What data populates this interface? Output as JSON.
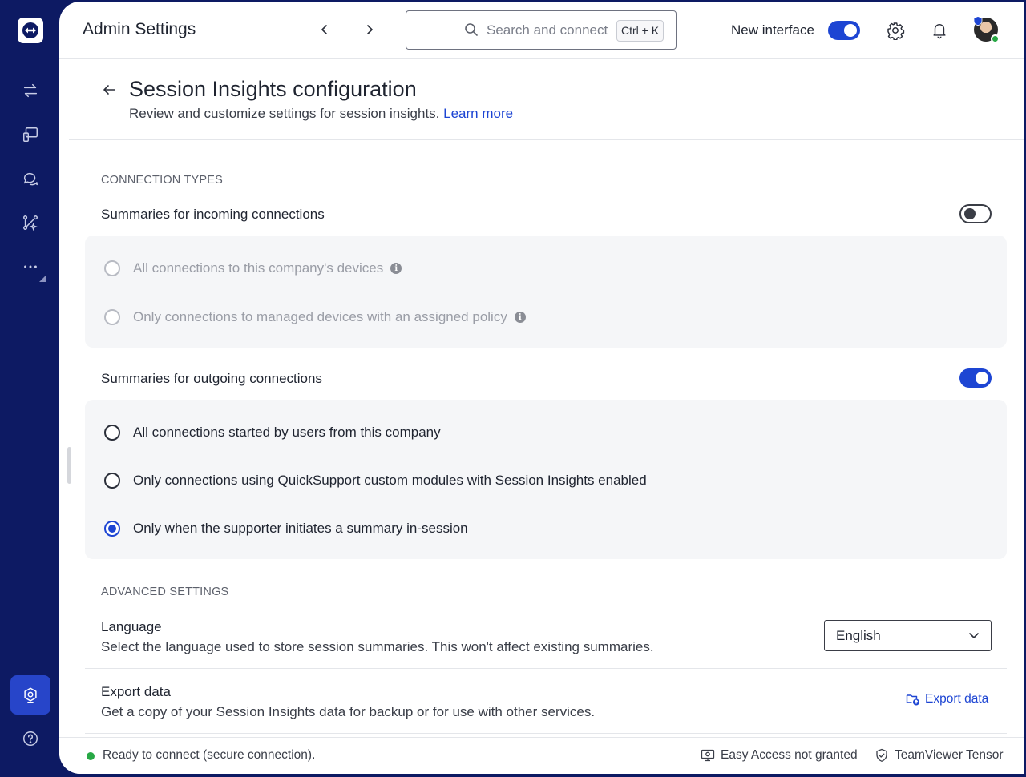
{
  "header": {
    "app_title": "Admin Settings",
    "search_placeholder": "Search and connect",
    "search_shortcut": "Ctrl + K",
    "new_interface_label": "New interface",
    "new_interface_enabled": true
  },
  "sidebar": {
    "items": [
      {
        "name": "remote-connect",
        "icon": "arrows-exchange-icon"
      },
      {
        "name": "devices",
        "icon": "devices-icon"
      },
      {
        "name": "chat",
        "icon": "chat-icon"
      },
      {
        "name": "integrations",
        "icon": "flow-sparkle-icon"
      },
      {
        "name": "more",
        "icon": "more-dots-icon"
      },
      {
        "name": "admin-settings",
        "icon": "admin-gear-shield-icon",
        "active": true
      },
      {
        "name": "help",
        "icon": "help-icon"
      }
    ]
  },
  "page": {
    "title": "Session Insights configuration",
    "subtitle": "Review and customize settings for session insights.",
    "learn_more": "Learn more"
  },
  "connection_types": {
    "section_label": "CONNECTION TYPES",
    "incoming": {
      "title": "Summaries for incoming connections",
      "enabled": false,
      "options": [
        {
          "label": "All connections to this company's devices",
          "checked": false,
          "disabled": true,
          "info": true
        },
        {
          "label": "Only connections to managed devices with an assigned policy",
          "checked": false,
          "disabled": true,
          "info": true
        }
      ]
    },
    "outgoing": {
      "title": "Summaries for outgoing connections",
      "enabled": true,
      "options": [
        {
          "label": "All connections started by users from this company",
          "checked": false,
          "disabled": false
        },
        {
          "label": "Only connections using QuickSupport custom modules with Session Insights enabled",
          "checked": false,
          "disabled": false
        },
        {
          "label": "Only when the supporter initiates a summary in-session",
          "checked": true,
          "disabled": false
        }
      ]
    }
  },
  "advanced": {
    "section_label": "ADVANCED SETTINGS",
    "language": {
      "title": "Language",
      "description": "Select the language used to store session summaries. This won't affect existing summaries.",
      "selected": "English"
    },
    "export": {
      "title": "Export data",
      "description": "Get a copy of your Session Insights data for backup or for use with other services.",
      "action_label": "Export data"
    }
  },
  "status": {
    "connection": "Ready to connect (secure connection).",
    "easy_access": "Easy Access not granted",
    "product": "TeamViewer Tensor"
  },
  "colors": {
    "sidebar": "#0d1a63",
    "accent": "#1d45d3",
    "status_ok": "#27a845"
  }
}
